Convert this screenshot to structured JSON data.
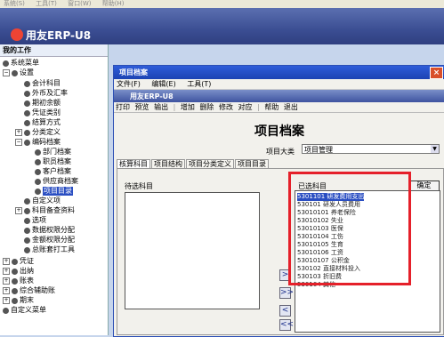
{
  "top_menu": [
    "系统(S)",
    "工具(T)",
    "窗口(W)",
    "帮助(H)"
  ],
  "brand": {
    "main": "用友ERP-U8",
    "window": "用友ERP-U8"
  },
  "sidebar": {
    "title": "我的工作",
    "items": [
      {
        "label": "系统菜单"
      },
      {
        "label": "设置"
      },
      {
        "label": "会计科目"
      },
      {
        "label": "外币及汇率"
      },
      {
        "label": "期初余额"
      },
      {
        "label": "凭证类别"
      },
      {
        "label": "结算方式"
      },
      {
        "label": "分类定义"
      },
      {
        "label": "编码档案"
      },
      {
        "label": "部门档案"
      },
      {
        "label": "职员档案"
      },
      {
        "label": "客户档案"
      },
      {
        "label": "供应商档案"
      },
      {
        "label": "项目目录"
      },
      {
        "label": "自定义项"
      },
      {
        "label": "科目备查资料"
      },
      {
        "label": "选项"
      },
      {
        "label": "数据权限分配"
      },
      {
        "label": "金额权限分配"
      },
      {
        "label": "总账套打工具"
      },
      {
        "label": "凭证"
      },
      {
        "label": "出纳"
      },
      {
        "label": "账表"
      },
      {
        "label": "综合辅助账"
      },
      {
        "label": "期末"
      },
      {
        "label": "自定义菜单"
      }
    ]
  },
  "window": {
    "title": "项目档案",
    "close": "×",
    "menu": [
      "文件(F)",
      "编辑(E)",
      "工具(T)"
    ],
    "toolbar": [
      "打印",
      "预览",
      "输出",
      "增加",
      "删除",
      "修改",
      "对应",
      "帮助",
      "退出"
    ],
    "page_title": "项目档案",
    "category_label": "项目大类",
    "category_value": "项目管理",
    "tabs": [
      "核算科目",
      "项目结构",
      "项目分类定义",
      "项目目录"
    ],
    "pending_label": "待选科目",
    "selected_label": "已选科目",
    "confirm": "确定",
    "buttons": [
      ">",
      ">>",
      "<",
      "<<"
    ],
    "selected_subjects": [
      "5301101 研发费用支出",
      "530101  研发人员费用",
      "53010101 养老保险",
      "53010102 失业",
      "53010103 医保",
      "53010104 工伤",
      "53010105 生育",
      "53010106 工资",
      "53010107 公积金",
      "530102  直接材料投入",
      "530103  折旧费",
      "530104  其他"
    ]
  }
}
